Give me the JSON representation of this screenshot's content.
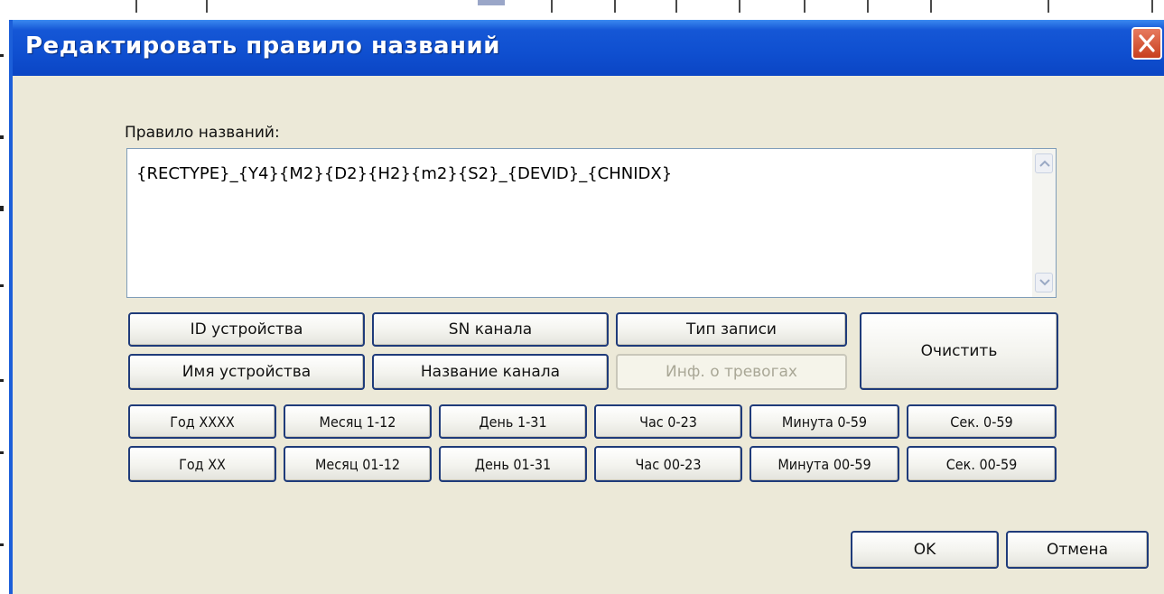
{
  "dialog": {
    "title": "Редактировать правило названий",
    "close_icon": "close-icon"
  },
  "rule": {
    "label": "Правило названий:",
    "value": "{RECTYPE}_{Y4}{M2}{D2}{H2}{m2}{S2}_{DEVID}_{CHNIDX}"
  },
  "tokens": {
    "device_id": "ID устройства",
    "channel_sn": "SN канала",
    "record_type": "Тип записи",
    "device_name": "Имя устройства",
    "channel_name": "Название канала",
    "alarm_info": "Инф. о тревогах",
    "clear": "Очистить"
  },
  "time_tokens": {
    "row1": [
      "Год XXXX",
      "Месяц 1-12",
      "День 1-31",
      "Час 0-23",
      "Минута 0-59",
      "Сек. 0-59"
    ],
    "row2": [
      "Год XX",
      "Месяц 01-12",
      "День 01-31",
      "Час 00-23",
      "Минута 00-59",
      "Сек. 00-59"
    ]
  },
  "actions": {
    "ok": "OK",
    "cancel": "Отмена"
  },
  "colors": {
    "titlebar": "#0f4fd0",
    "dialog_bg": "#ece9d8",
    "button_border": "#1f3b7a",
    "close_button": "#c8401f"
  }
}
